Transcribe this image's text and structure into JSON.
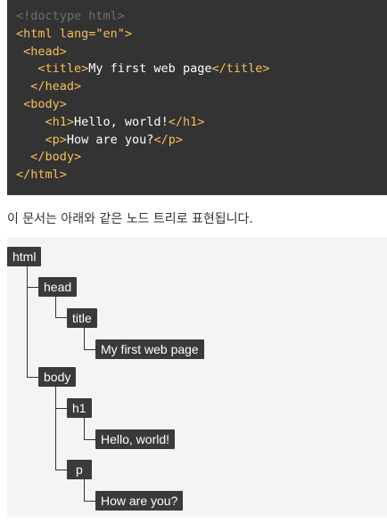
{
  "code": {
    "lines": [
      [
        {
          "t": "<!doctype html>",
          "c": "comment"
        }
      ],
      [
        {
          "t": "<html ",
          "c": "tag"
        },
        {
          "t": "lang=",
          "c": "attr"
        },
        {
          "t": "\"en\"",
          "c": "string"
        },
        {
          "t": ">",
          "c": "tag"
        }
      ],
      [
        {
          "t": " <head>",
          "c": "tag"
        }
      ],
      [
        {
          "t": "   <title>",
          "c": "tag"
        },
        {
          "t": "My first web page",
          "c": "text"
        },
        {
          "t": "</title>",
          "c": "tag"
        }
      ],
      [
        {
          "t": "  </head>",
          "c": "tag"
        }
      ],
      [
        {
          "t": " <body>",
          "c": "tag"
        }
      ],
      [
        {
          "t": "    <h1>",
          "c": "tag"
        },
        {
          "t": "Hello, world!",
          "c": "text"
        },
        {
          "t": "</h1>",
          "c": "tag"
        }
      ],
      [
        {
          "t": "    <p>",
          "c": "tag"
        },
        {
          "t": "How are you?",
          "c": "text"
        },
        {
          "t": "</p>",
          "c": "tag"
        }
      ],
      [
        {
          "t": "  </body>",
          "c": "tag"
        }
      ],
      [
        {
          "t": "</html>",
          "c": "tag"
        }
      ]
    ]
  },
  "caption": "이 문서는 아래와 같은 노드 트리로 표현됩니다.",
  "tree": {
    "html": "html",
    "head": "head",
    "title": "title",
    "title_text": "My first web page",
    "body": "body",
    "h1": "h1",
    "h1_text": "Hello, world!",
    "p": "p",
    "p_text": "How are you?"
  },
  "colors": {
    "code_bg": "#333333",
    "tag": "#f7bf5b",
    "comment": "#6f6f6f",
    "node_bg": "#3a3a3a",
    "panel_bg": "#f4f4f4"
  }
}
